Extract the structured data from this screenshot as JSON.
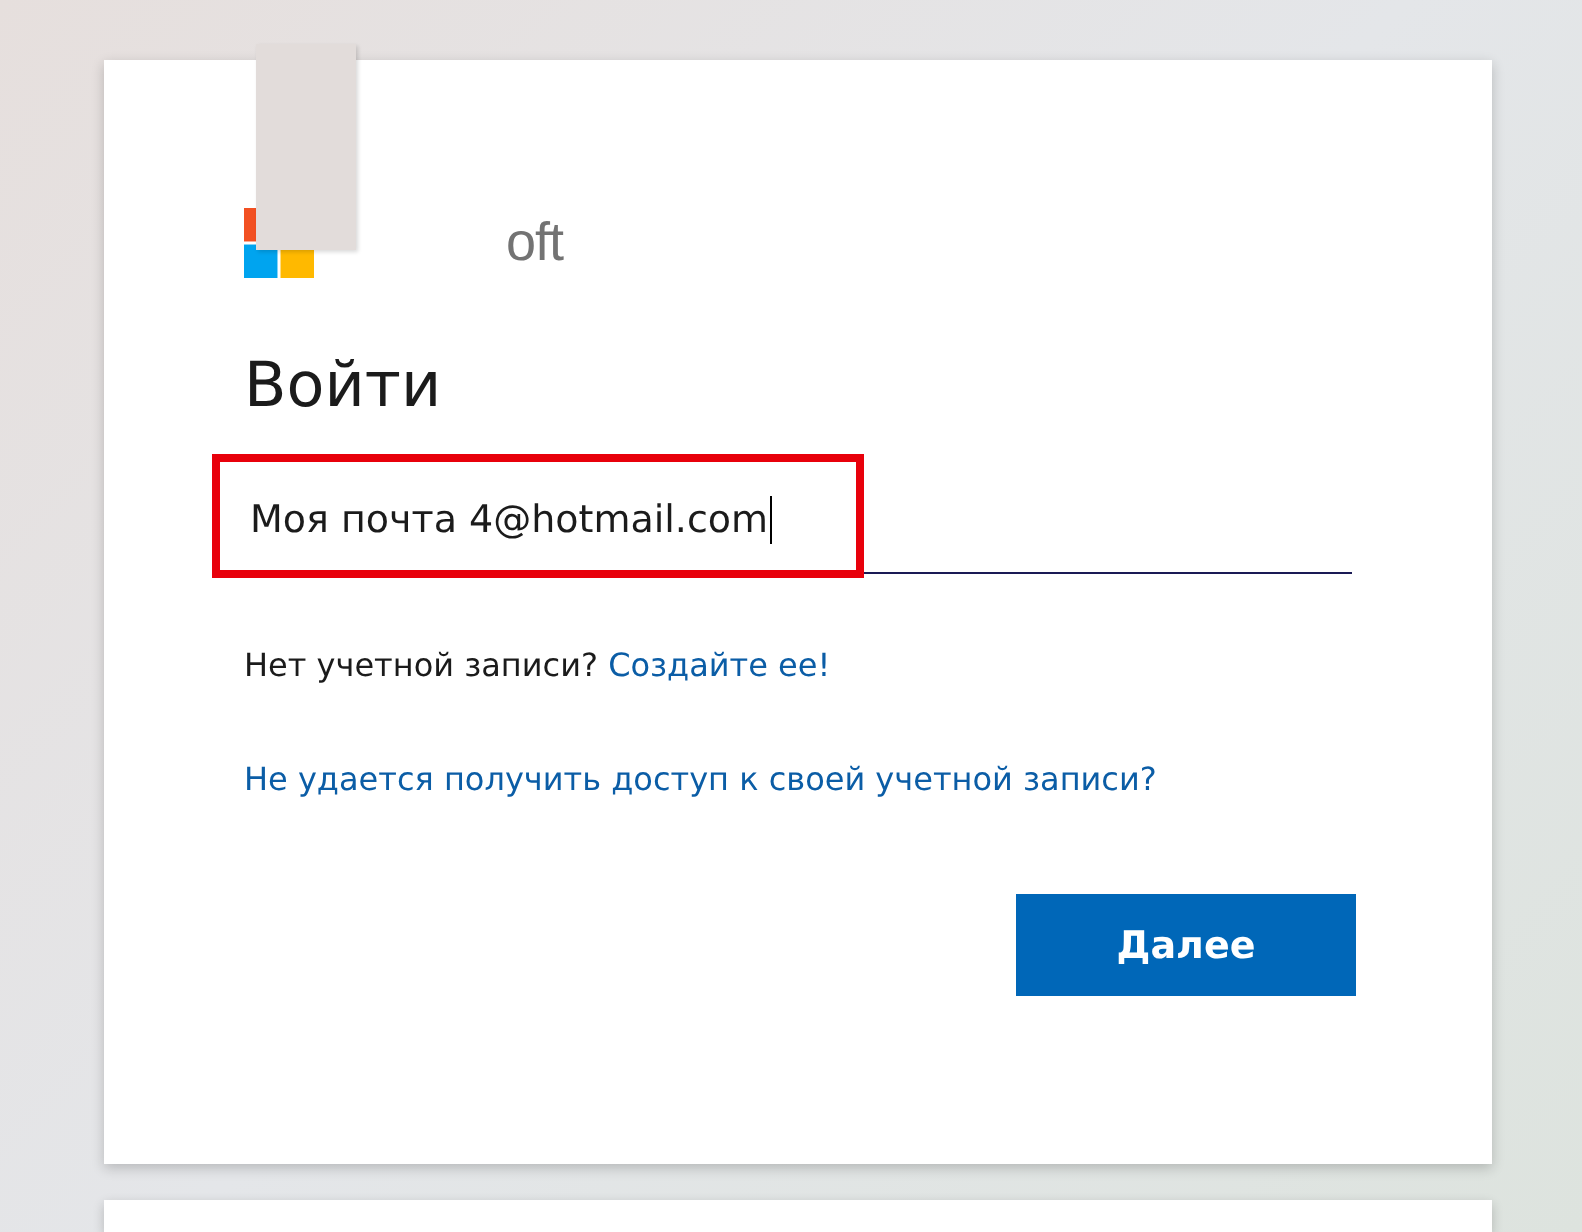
{
  "logo": {
    "wordmark": "oft"
  },
  "title": "Войти",
  "email_field": {
    "value": "Моя почта 4@hotmail.com"
  },
  "no_account": {
    "text": "Нет учетной записи?",
    "link": "Создайте ее!"
  },
  "access_link": "Не удается получить доступ к своей учетной записи?",
  "next_button": "Далее"
}
